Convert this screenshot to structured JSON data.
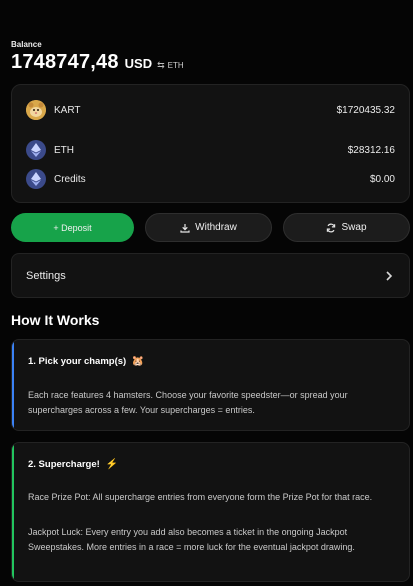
{
  "balance": {
    "label": "Balance",
    "value": "1748747,48",
    "currency": "USD",
    "swap_glyph": "⇆",
    "alt_currency": "ETH"
  },
  "assets": [
    {
      "name": "KART",
      "amount": "$1720435.32",
      "icon": "kart-hamster-icon"
    },
    {
      "name": "ETH",
      "amount": "$28312.16",
      "icon": "ethereum-icon"
    },
    {
      "name": "Credits",
      "amount": "$0.00",
      "icon": "ethereum-icon"
    }
  ],
  "actions": {
    "deposit_label": "+ Deposit",
    "withdraw_label": "Withdraw",
    "swap_label": "Swap"
  },
  "settings": {
    "label": "Settings"
  },
  "how_it_works": {
    "title": "How It Works",
    "steps": [
      {
        "title": "1. Pick your champ(s)",
        "emoji": "🐹",
        "paragraphs": [
          "Each race features 4 hamsters. Choose your favorite speedster—or spread your supercharges across a few. Your supercharges = entries."
        ]
      },
      {
        "title": "2. Supercharge!",
        "emoji": "⚡",
        "paragraphs": [
          "Race Prize Pot: All supercharge entries from everyone form the Prize Pot for that race.",
          "Jackpot Luck: Every entry you add also becomes a ticket in the ongoing Jackpot Sweepstakes. More entries in a race = more luck for the eventual jackpot drawing."
        ]
      }
    ]
  },
  "colors": {
    "deposit_green": "#17a34a",
    "step1_accent": "#3b82f6",
    "step2_accent": "#22c55e"
  }
}
